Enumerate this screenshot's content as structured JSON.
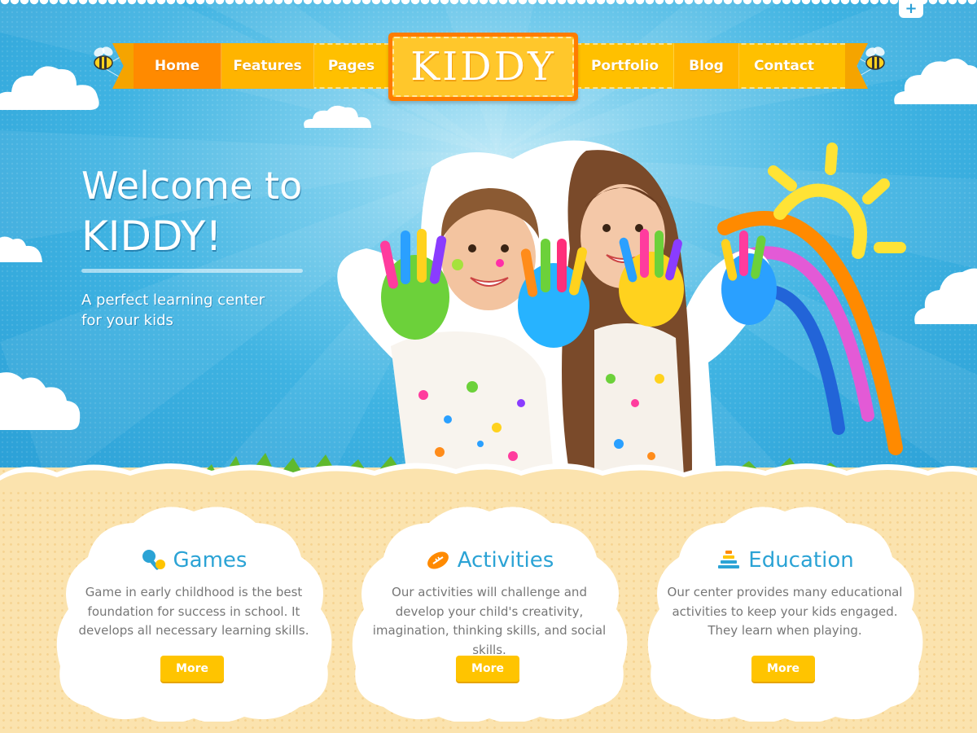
{
  "nav": {
    "left_items": [
      {
        "label": "Home",
        "active": true
      },
      {
        "label": "Features",
        "active": false
      },
      {
        "label": "Pages",
        "active": false
      }
    ],
    "right_items": [
      {
        "label": "Portfolio",
        "active": false
      },
      {
        "label": "Blog",
        "active": false
      },
      {
        "label": "Contact",
        "active": false
      }
    ]
  },
  "logo": {
    "text": "KIDDY"
  },
  "hero": {
    "title_line1": "Welcome to",
    "title_line2": "KIDDY!",
    "tagline_line1": "A perfect learning center",
    "tagline_line2": "for your kids"
  },
  "features": [
    {
      "title": "Games",
      "icon": "games-icon",
      "text": "Game in early childhood is the best foundation for success in school. It develops all necessary learning skills.",
      "button": "More"
    },
    {
      "title": "Activities",
      "icon": "football-icon",
      "text": "Our activities will challenge and develop your child's creativity, imagination, thinking skills, and social skills.",
      "button": "More"
    },
    {
      "title": "Education",
      "icon": "pyramid-stack-icon",
      "text": "Our center provides many educational activities to keep your kids engaged. They learn when playing.",
      "button": "More"
    }
  ],
  "colors": {
    "sky": "#2a9fd6",
    "nav_yellow": "#ffc000",
    "nav_active": "#ff8a00",
    "logo_orange": "#ff7c00",
    "title_blue": "#2ba3d5",
    "button_yellow": "#ffc400",
    "sand": "#fbe3ae"
  }
}
